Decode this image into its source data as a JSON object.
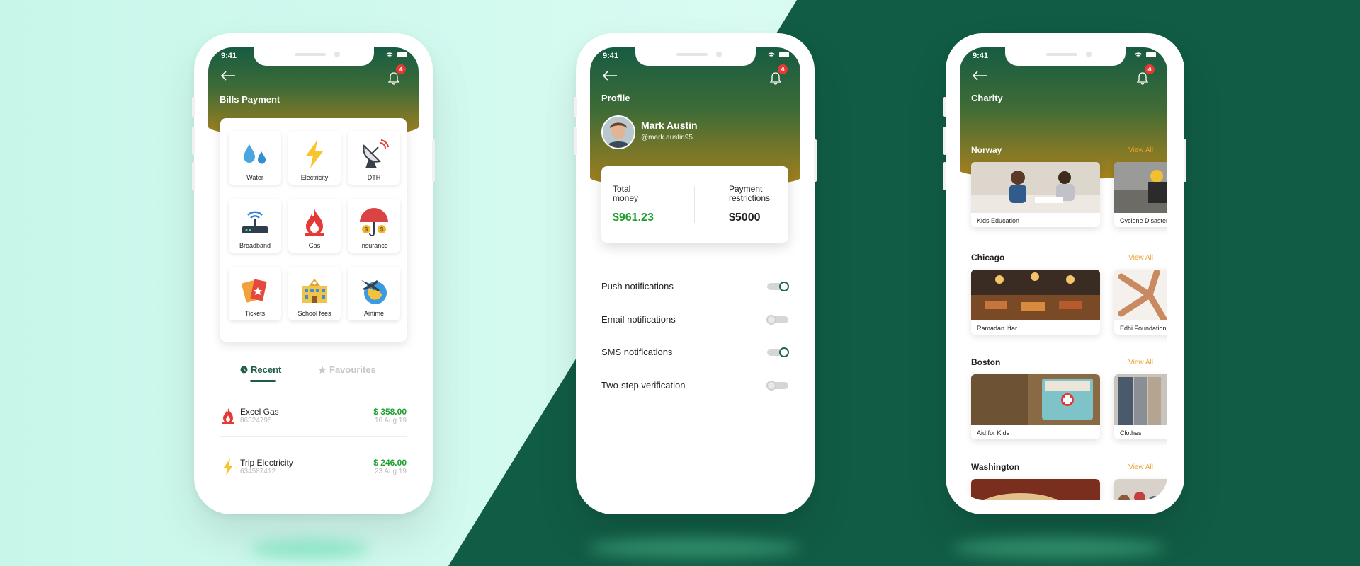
{
  "phone1": {
    "status_time": "9:41",
    "notification_count": "4",
    "title": "Bills Payment",
    "services": [
      {
        "label": "Water",
        "icon": "water-drops-icon"
      },
      {
        "label": "Electricity",
        "icon": "lightning-icon"
      },
      {
        "label": "DTH",
        "icon": "satellite-dish-icon"
      },
      {
        "label": "Broadband",
        "icon": "router-icon"
      },
      {
        "label": "Gas",
        "icon": "gas-flame-icon"
      },
      {
        "label": "Insurance",
        "icon": "umbrella-icon"
      },
      {
        "label": "Tickets",
        "icon": "tickets-icon"
      },
      {
        "label": "School fees",
        "icon": "school-icon"
      },
      {
        "label": "Airtime",
        "icon": "globe-plane-icon"
      }
    ],
    "tabs": {
      "recent": "Recent",
      "favourites": "Favourites"
    },
    "transactions": [
      {
        "name": "Excel Gas",
        "id": "86324795",
        "amount": "$ 358.00",
        "date": "16 Aug 19"
      },
      {
        "name": "Trip Electricity",
        "id": "634587412",
        "amount": "$ 246.00",
        "date": "23 Aug 19"
      }
    ]
  },
  "phone2": {
    "status_time": "9:41",
    "notification_count": "4",
    "title": "Profile",
    "name": "Mark Austin",
    "handle": "@mark.austin95",
    "total_money_label_1": "Total",
    "total_money_label_2": "money",
    "total_money_value": "$961.23",
    "payment_label_1": "Payment",
    "payment_label_2": "restrictions",
    "payment_value": "$5000",
    "settings": [
      {
        "label": "Push notifications",
        "on": true
      },
      {
        "label": "Email notifications",
        "on": false
      },
      {
        "label": "SMS notifications",
        "on": true
      },
      {
        "label": "Two-step verification",
        "on": false
      }
    ]
  },
  "phone3": {
    "status_time": "9:41",
    "notification_count": "4",
    "title": "Charity",
    "view_all": "View All",
    "cities": [
      {
        "name": "Norway",
        "items": [
          "Kids Education",
          "Cyclone Disaster"
        ]
      },
      {
        "name": "Chicago",
        "items": [
          "Ramadan Iftar",
          "Edhi Foundation"
        ]
      },
      {
        "name": "Boston",
        "items": [
          "Aid for Kids",
          "Clothes"
        ]
      },
      {
        "name": "Washington",
        "items": [
          "",
          ""
        ]
      }
    ]
  },
  "colors": {
    "accent_green": "#1e5d44",
    "money_green": "#1f9f2e",
    "gold": "#a9811e",
    "view_all": "#e9a22b"
  }
}
